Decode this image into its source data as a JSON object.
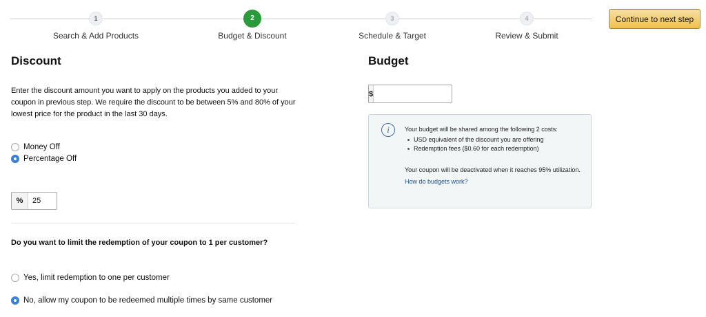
{
  "stepper": {
    "steps": [
      {
        "number": "1",
        "label": "Search & Add Products"
      },
      {
        "number": "2",
        "label": "Budget & Discount"
      },
      {
        "number": "3",
        "label": "Schedule & Target"
      },
      {
        "number": "4",
        "label": "Review & Submit"
      }
    ],
    "active_step": 2,
    "continue_label": "Continue to next step"
  },
  "discount": {
    "title": "Discount",
    "description": "Enter the discount amount you want to apply on the products you added to your coupon in previous step. We require the discount to be between 5% and 80% of your lowest price for the product in the last 30 days.",
    "type_options": [
      {
        "label": "Money Off",
        "selected": false
      },
      {
        "label": "Percentage Off",
        "selected": true
      }
    ],
    "percent_prefix": "%",
    "percent_value": "25"
  },
  "redemption": {
    "question": "Do you want to limit the redemption of your coupon to 1 per customer?",
    "options": [
      {
        "label": "Yes, limit redemption to one per customer",
        "selected": false
      },
      {
        "label": "No, allow my coupon to be redeemed multiple times by same customer",
        "selected": true
      }
    ]
  },
  "budget": {
    "title": "Budget",
    "currency_prefix": "$",
    "value": "",
    "info": {
      "icon": "info-icon",
      "intro": "Your budget will be shared among the following 2 costs:",
      "costs": [
        "USD equivalent of the discount you are offering",
        "Redemption fees ($0.60 for each redemption)"
      ],
      "deactivation_note": "Your coupon will be deactivated when it reaches 95% utilization.",
      "link_label": "How do budgets work?"
    }
  },
  "colors": {
    "active_step": "#2b9a3d",
    "radio_selected": "#3a7fd9",
    "button": "#f0c14b",
    "link": "#1a4f8a",
    "info_panel_bg": "#f3f6f7"
  }
}
